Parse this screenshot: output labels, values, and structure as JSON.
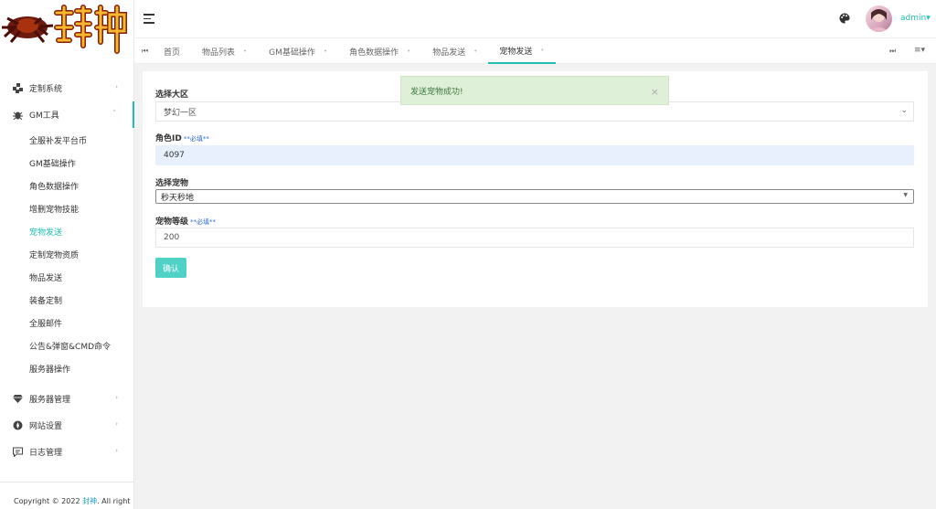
{
  "sidebar": {
    "logo_alt": "封神",
    "menu": [
      {
        "label": "定制系统",
        "icon": "puzzle-icon",
        "caret": "›"
      },
      {
        "label": "GM工具",
        "icon": "bug-icon",
        "caret": "˅"
      }
    ],
    "sub_items": [
      "全服补发平台币",
      "GM基础操作",
      "角色数据操作",
      "增删宠物技能",
      "宠物发送",
      "定制宠物资质",
      "物品发送",
      "装备定制",
      "全服邮件",
      "公告&弹窗&CMD命令",
      "服务器操作"
    ],
    "menu_bottom": [
      {
        "label": "服务器管理",
        "icon": "diamond-icon",
        "caret": "›"
      },
      {
        "label": "网站设置",
        "icon": "compass-icon",
        "caret": "›"
      },
      {
        "label": "日志管理",
        "icon": "message-icon",
        "caret": "›"
      }
    ],
    "copyright_prefix": "Copyright © 2022 ",
    "copyright_brand": "封神",
    "copyright_suffix": ". All right"
  },
  "header": {
    "user": "admin",
    "user_caret": "▾"
  },
  "tabs": {
    "prev": "⏮",
    "next": "⏭",
    "menu": "≡▾",
    "items": [
      {
        "label": "首页",
        "close": ""
      },
      {
        "label": "物品列表",
        "close": "•"
      },
      {
        "label": "GM基础操作",
        "close": "•"
      },
      {
        "label": "角色数据操作",
        "close": "•"
      },
      {
        "label": "物品发送",
        "close": "•"
      },
      {
        "label": "宠物发送",
        "close": "•"
      }
    ]
  },
  "form": {
    "region_label": "选择大区",
    "region_value": "梦幻一区",
    "role_label": "角色ID",
    "role_required": "**必填**",
    "role_value": "4097",
    "pet_label": "选择宠物",
    "pet_value": "秒天秒地",
    "level_label": "宠物等级",
    "level_required": "**必填**",
    "level_value": "200",
    "confirm": "确认"
  },
  "toast": {
    "message": "发送宠物成功!",
    "close": "×"
  },
  "colors": {
    "accent": "#20c0b0",
    "button": "#4fd1c5",
    "toast_bg": "#dff0d8",
    "toast_text": "#3c763d"
  }
}
